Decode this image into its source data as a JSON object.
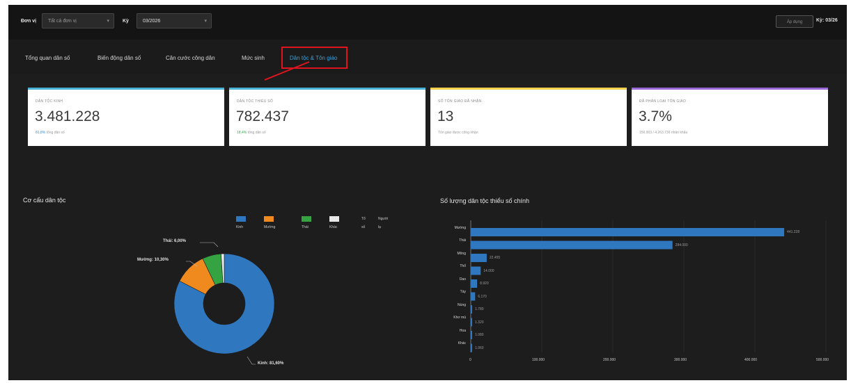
{
  "topbar": {
    "filter1_label": "Đơn vị",
    "filter1_value": "Tất cả đơn vị",
    "filter2_label": "Kỳ",
    "filter2_value": "03/2026",
    "button_label": "Áp dụng",
    "right_text": "Kỳ: 03/26"
  },
  "tabs": [
    {
      "label": "Tổng quan dân số"
    },
    {
      "label": "Biến động dân số"
    },
    {
      "label": "Căn cước công dân"
    },
    {
      "label": "Mức sinh"
    },
    {
      "label": "Dân tộc & Tôn giáo"
    }
  ],
  "cards": [
    {
      "label": "DÂN TỘC KINH",
      "value": "3.481.228",
      "sub_pct": "81,8%",
      "sub_text": "tổng dân số",
      "accent": "#4ab3d8"
    },
    {
      "label": "DÂN TỘC THIỂU SỐ",
      "value": "782.437",
      "sub_pct": "18,4%",
      "sub_text": "tổng dân số",
      "accent": "#4ab3d8"
    },
    {
      "label": "SỐ TÔN GIÁO ĐÃ NHẬN",
      "value": "13",
      "sub_pct": "",
      "sub_text": "Tôn giáo được công nhận",
      "accent": "#f2d24b"
    },
    {
      "label": "ĐÃ PHÂN LOẠI TÔN GIÁO",
      "value": "3.7%",
      "sub_pct": "",
      "sub_text": "156.903 / 4.263.736 nhân khẩu",
      "accent": "#9b6ad8"
    }
  ],
  "pie_section": {
    "title": "Cơ cấu dân tộc"
  },
  "bar_section": {
    "title": "Số lượng dân tộc thiểu số chính"
  },
  "chart_data": [
    {
      "type": "pie",
      "title": "Cơ cấu dân tộc",
      "legend": [
        "Kinh",
        "Mường",
        "Thái",
        "Khác",
        "Tổ số",
        "Người lạ"
      ],
      "slices": [
        {
          "name": "Kinh",
          "value": 81.6,
          "color": "#2f78c0"
        },
        {
          "name": "Mường",
          "value": 10.3,
          "color": "#f08a1e"
        },
        {
          "name": "Thái",
          "value": 6.0,
          "color": "#36a342"
        },
        {
          "name": "Khác",
          "value": 1.0,
          "color": "#e8e8e8"
        }
      ],
      "labels": [
        "Thái: 6,00%",
        "Mường: 10,30%",
        "Kinh: 81,60%"
      ]
    },
    {
      "type": "bar",
      "orientation": "horizontal",
      "title": "Số lượng dân tộc thiểu số chính",
      "categories": [
        "Mường",
        "Thái",
        "Mông",
        "Thổ",
        "Dao",
        "Tày",
        "Nùng",
        "Khơ mú",
        "Hoa",
        "Khác"
      ],
      "values": [
        441228,
        284000,
        22455,
        14000,
        8920,
        6170,
        1780,
        1320,
        1080,
        1060
      ],
      "value_labels": [
        "441.228",
        "284.000",
        "22.455",
        "14.000",
        "8.920",
        "6.170",
        "1.780",
        "1.320",
        "1.080",
        "1.060"
      ],
      "xlim": [
        0,
        1000000
      ],
      "xticks": [
        "0",
        "100.000",
        "200.000",
        "300.000",
        "400.000",
        "500.000"
      ],
      "color": "#2f78c0"
    }
  ]
}
